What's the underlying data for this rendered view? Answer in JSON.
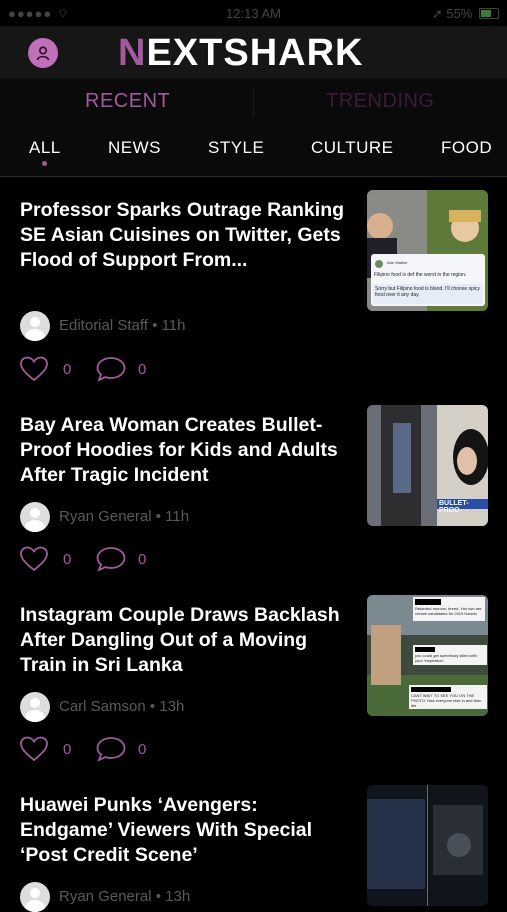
{
  "status_bar": {
    "time": "12:13 AM",
    "battery": "55%"
  },
  "header": {
    "logo_first": "N",
    "logo_rest": "EXTSHARK",
    "profile_icon": "user-icon"
  },
  "segments": [
    "RECENT",
    "TRENDING"
  ],
  "categories": [
    "ALL",
    "NEWS",
    "STYLE",
    "CULTURE",
    "FOOD"
  ],
  "articles": [
    {
      "title": "Professor Sparks Outrage Ranking SE Asian Cuisines on Twitter, Gets Flood of Support From...",
      "author": "Editorial Staff",
      "age": "11h",
      "likes": "0",
      "comments": "0",
      "thumb_text": {
        "tweet_name": "Ade Walker",
        "line1": "Filipino food is def the worst in the region.",
        "line2": "Sorry but Filipino food is bland. I'll choose spicy food over it any day."
      }
    },
    {
      "title": "Bay Area Woman Creates Bullet-Proof Hoodies for Kids and Adults After Tragic Incident",
      "author": "Ryan General",
      "age": "11h",
      "likes": "0",
      "comments": "0",
      "thumb_text": {
        "caption": "BULLET-PROO"
      }
    },
    {
      "title": "Instagram Couple Draws Backlash After Dangling Out of a Moving Train in Sri Lanka",
      "author": "Carl Samson",
      "age": "13h",
      "likes": "0",
      "comments": "0",
      "thumb_text": {
        "c1": "Retarded morons, breed. You two are certain candidates for 2019 Darwin",
        "c2": "you could get somebody killed with your 'inspiration'",
        "c3": "CANT WAIT TO SEE YOU ON THE PHOTO. Has everyone else in and then die"
      }
    },
    {
      "title": "Huawei Punks ‘Avengers: Endgame’ Viewers With Special ‘Post Credit Scene’",
      "author": "Ryan General",
      "age": "13h",
      "likes": "0",
      "comments": "0",
      "thumb_text": {}
    }
  ]
}
